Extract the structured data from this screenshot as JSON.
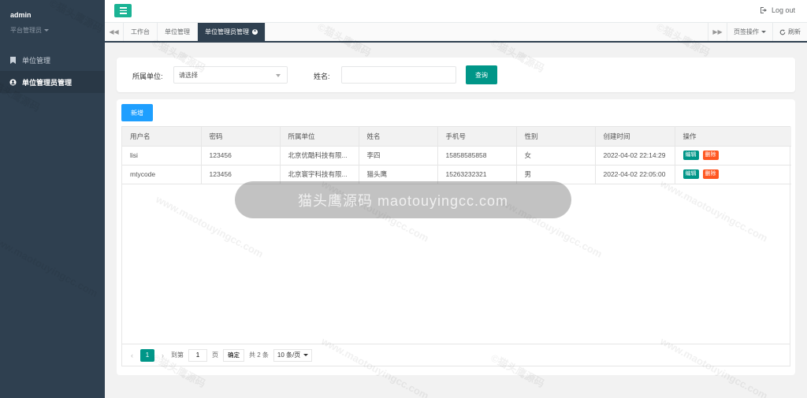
{
  "user": {
    "name": "admin",
    "role": "平台管理员"
  },
  "sidebar": {
    "items": [
      {
        "label": "单位管理",
        "icon": "bookmark-icon",
        "active": false
      },
      {
        "label": "单位管理员管理",
        "icon": "user-circle-icon",
        "active": true
      }
    ]
  },
  "topbar": {
    "logout_label": "Log out"
  },
  "tabs": {
    "items": [
      {
        "label": "工作台"
      },
      {
        "label": "单位管理"
      },
      {
        "label": "单位管理员管理",
        "active": true
      }
    ],
    "page_ops_label": "页签操作",
    "refresh_label": "刷新"
  },
  "search": {
    "unit_label": "所属单位:",
    "unit_placeholder": "请选择",
    "name_label": "姓名:",
    "name_value": "",
    "query_label": "查询"
  },
  "toolbar": {
    "add_label": "新增"
  },
  "table": {
    "columns": [
      "用户名",
      "密码",
      "所属单位",
      "姓名",
      "手机号",
      "性别",
      "创建时间",
      "操作"
    ],
    "rows": [
      {
        "username": "lisi",
        "password": "123456",
        "unit": "北京优酷科技有限...",
        "name": "李四",
        "phone": "15858585858",
        "gender": "女",
        "created": "2022-04-02 22:14:29"
      },
      {
        "username": "mtycode",
        "password": "123456",
        "unit": "北京寰宇科技有限...",
        "name": "猫头鹰",
        "phone": "15263232321",
        "gender": "男",
        "created": "2022-04-02 22:05:00"
      }
    ],
    "edit_label": "编辑",
    "delete_label": "删除"
  },
  "pager": {
    "current_page": "1",
    "goto_label": "到第",
    "goto_value": "1",
    "page_unit": "页",
    "confirm_label": "确定",
    "total_label": "共 2 条",
    "page_size_label": "10 条/页"
  },
  "toast": {
    "text": "猫头鹰源码 maotouyingcc.com"
  },
  "watermark": {
    "line1": "©猫头鹰源码",
    "line2": "www.maotouyingcc.com"
  },
  "colors": {
    "sidebar": "#2f4050",
    "primary": "#009688",
    "blue": "#1e9fff",
    "danger": "#ff5722",
    "toggle": "#1ab394"
  }
}
